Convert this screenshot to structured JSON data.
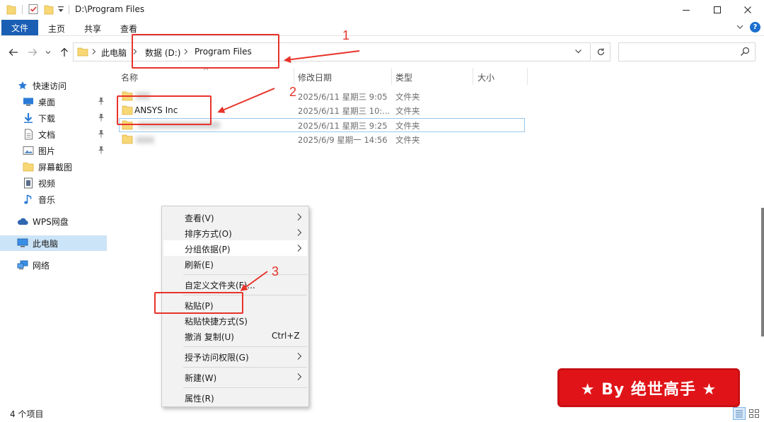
{
  "window": {
    "title": "D:\\Program Files",
    "minimize": "minimize",
    "maximize": "maximize",
    "close": "close"
  },
  "ribbon": {
    "tabs": [
      {
        "label": "文件",
        "active": true
      },
      {
        "label": "主页"
      },
      {
        "label": "共享"
      },
      {
        "label": "查看"
      }
    ],
    "help": "?"
  },
  "address": {
    "breadcrumbs": [
      "此电脑",
      "数据 (D:)",
      "Program Files"
    ],
    "search_placeholder": ""
  },
  "sidebar": {
    "items": [
      {
        "label": "快速访问",
        "icon": "star-icon"
      },
      {
        "label": "桌面",
        "icon": "desktop-icon",
        "pinned": true
      },
      {
        "label": "下载",
        "icon": "download-icon",
        "pinned": true
      },
      {
        "label": "文档",
        "icon": "document-icon",
        "pinned": true
      },
      {
        "label": "图片",
        "icon": "pictures-icon",
        "pinned": true
      },
      {
        "label": "屏幕截图",
        "icon": "folder-icon"
      },
      {
        "label": "视频",
        "icon": "video-icon"
      },
      {
        "label": "音乐",
        "icon": "music-icon"
      },
      {
        "label": "WPS网盘",
        "icon": "cloud-icon"
      },
      {
        "label": "此电脑",
        "icon": "computer-icon",
        "selected": true
      },
      {
        "label": "网络",
        "icon": "network-icon"
      }
    ]
  },
  "file_list": {
    "columns": [
      "名称",
      "修改日期",
      "类型",
      "大小"
    ],
    "rows": [
      {
        "name": "",
        "date": "2025/6/11 星期三 9:05",
        "type": "文件夹",
        "blurred": true
      },
      {
        "name": "ANSYS Inc",
        "date": "2025/6/11 星期三 10:...",
        "type": "文件夹"
      },
      {
        "name": "",
        "date": "2025/6/11 星期三 9:25",
        "type": "文件夹",
        "blurred": true,
        "focused": true
      },
      {
        "name": "",
        "date": "2025/6/9 星期一 14:56",
        "type": "文件夹",
        "blurred": true
      }
    ]
  },
  "context_menu": {
    "items": [
      {
        "label": "查看(V)",
        "submenu": true
      },
      {
        "label": "排序方式(O)",
        "submenu": true
      },
      {
        "label": "分组依据(P)",
        "submenu": true
      },
      {
        "label": "刷新(E)"
      },
      {
        "label": "自定义文件夹(F)..."
      },
      {
        "label": "粘贴(P)"
      },
      {
        "label": "粘贴快捷方式(S)"
      },
      {
        "label": "撤消 复制(U)",
        "shortcut": "Ctrl+Z"
      },
      {
        "label": "授予访问权限(G)",
        "submenu": true
      },
      {
        "label": "新建(W)",
        "submenu": true
      },
      {
        "label": "属性(R)"
      }
    ]
  },
  "annotations": [
    "1",
    "2",
    "3"
  ],
  "watermark": "★ By 绝世高手 ★",
  "status": {
    "item_count": "4 个项目"
  },
  "colors": {
    "accent": "#1a5fb4",
    "annotation": "#e8332a",
    "watermark_bg": "#e01418",
    "selection": "#cce4f7"
  }
}
